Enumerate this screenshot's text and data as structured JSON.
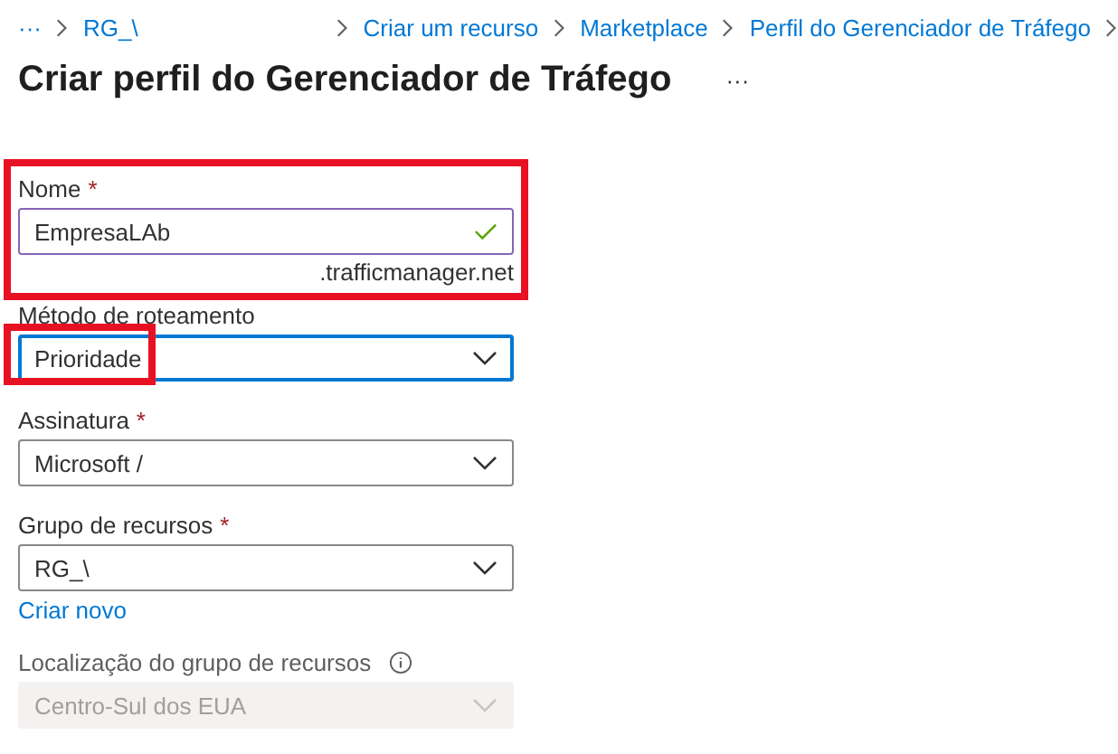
{
  "breadcrumb": [
    {
      "label": "···",
      "kind": "overflow"
    },
    {
      "label": "RG_\\",
      "kind": "link"
    },
    {
      "label": "Criar um recurso",
      "kind": "link"
    },
    {
      "label": "Marketplace",
      "kind": "link"
    },
    {
      "label": "Perfil do Gerenciador de Tráfego",
      "kind": "link"
    }
  ],
  "title": "Criar perfil do Gerenciador de Tráfego",
  "title_menu": "···",
  "fields": [
    {
      "kind": "text",
      "label": "Nome",
      "required_mark": "*",
      "value": "EmpresaLAb",
      "valid": true,
      "suffix": ".trafficmanager.net",
      "focused": false,
      "disabled": false,
      "highlighted": true,
      "value_highlighted": false
    },
    {
      "kind": "dropdown",
      "label": "Método de roteamento",
      "value": "Prioridade",
      "focused": true,
      "disabled": false,
      "highlighted": false,
      "value_highlighted": true
    },
    {
      "kind": "dropdown",
      "label": "Assinatura",
      "required_mark": "*",
      "value": "Microsoft /",
      "focused": false,
      "disabled": false,
      "highlighted": false,
      "value_highlighted": false
    },
    {
      "kind": "dropdown",
      "label": "Grupo de recursos",
      "required_mark": "*",
      "value": "RG_\\",
      "focused": false,
      "disabled": false,
      "highlighted": false,
      "value_highlighted": false,
      "link": "Criar novo"
    },
    {
      "kind": "dropdown",
      "label": "Localização do grupo de recursos",
      "info": true,
      "value": "Centro-Sul dos EUA",
      "focused": false,
      "disabled": true,
      "highlighted": false,
      "value_highlighted": false
    }
  ]
}
